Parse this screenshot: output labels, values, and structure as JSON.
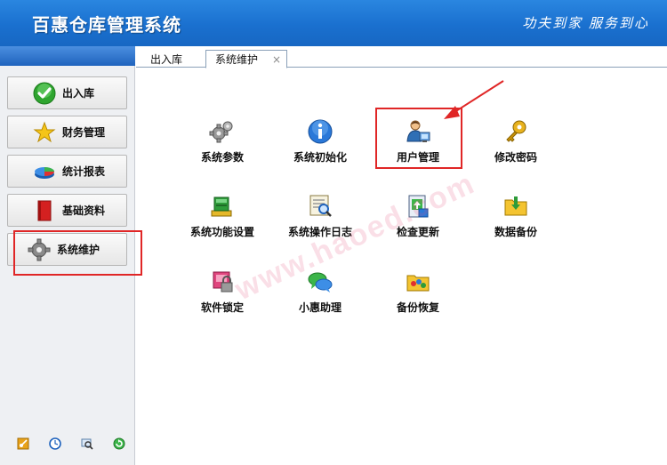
{
  "header": {
    "app_title": "百惠仓库管理系统",
    "slogan": "功夫到家 服务到心",
    "accent_color": "#1a70cf"
  },
  "sidebar": {
    "items": [
      {
        "label": "出入库",
        "icon": "check-circle-icon"
      },
      {
        "label": "财务管理",
        "icon": "star-icon"
      },
      {
        "label": "统计报表",
        "icon": "pie-chart-icon"
      },
      {
        "label": "基础资料",
        "icon": "book-icon"
      },
      {
        "label": "系统维护",
        "icon": "gear-icon",
        "selected": true
      }
    ],
    "footer_icons": [
      "key-icon",
      "clock-icon",
      "search-icon",
      "refresh-icon"
    ]
  },
  "tabs": [
    {
      "label": "出入库",
      "active": false
    },
    {
      "label": "系统维护",
      "active": true,
      "close": "×"
    }
  ],
  "tiles": [
    {
      "label": "系统参数",
      "icon": "gears-icon"
    },
    {
      "label": "系统初始化",
      "icon": "info-icon"
    },
    {
      "label": "用户管理",
      "icon": "user-monitor-icon",
      "highlighted": true
    },
    {
      "label": "修改密码",
      "icon": "key-icon"
    },
    {
      "label": "系统功能设置",
      "icon": "function-settings-icon"
    },
    {
      "label": "系统操作日志",
      "icon": "log-icon"
    },
    {
      "label": "检查更新",
      "icon": "update-icon"
    },
    {
      "label": "数据备份",
      "icon": "backup-folder-icon"
    },
    {
      "label": "软件锁定",
      "icon": "lock-icon"
    },
    {
      "label": "小惠助理",
      "icon": "chat-bubbles-icon"
    },
    {
      "label": "备份恢复",
      "icon": "restore-folder-icon"
    }
  ],
  "watermark": "www.haoed.com",
  "annotation_color": "#e02626"
}
